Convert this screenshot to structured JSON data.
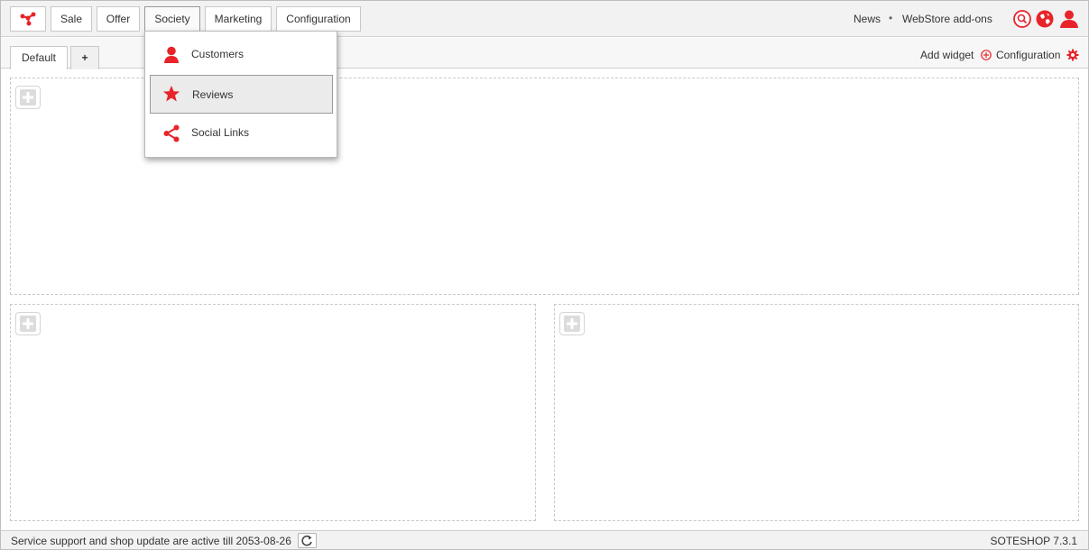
{
  "colors": {
    "accent": "#e8232a"
  },
  "topnav": {
    "logo_icon": "share-network-icon",
    "items": [
      {
        "label": "Sale"
      },
      {
        "label": "Offer"
      },
      {
        "label": "Society"
      },
      {
        "label": "Marketing"
      },
      {
        "label": "Configuration"
      }
    ],
    "active": "Society",
    "right_links": {
      "news": "News",
      "separator": "•",
      "webstore": "WebStore add-ons"
    },
    "right_icons": [
      "search-icon",
      "globe-icon",
      "user-icon"
    ]
  },
  "tabs": {
    "items": [
      {
        "label": "Default"
      },
      {
        "label": "+"
      }
    ]
  },
  "toolbar": {
    "add_widget": "Add widget",
    "configuration": "Configuration"
  },
  "dropdown": {
    "items": [
      {
        "label": "Customers",
        "icon": "user-icon"
      },
      {
        "label": "Reviews",
        "icon": "star-icon"
      },
      {
        "label": "Social Links",
        "icon": "share-icon"
      }
    ],
    "hovered": "Reviews"
  },
  "statusbar": {
    "text": "Service support and shop update are active till 2053-08-26",
    "version": "SOTESHOP 7.3.1"
  }
}
